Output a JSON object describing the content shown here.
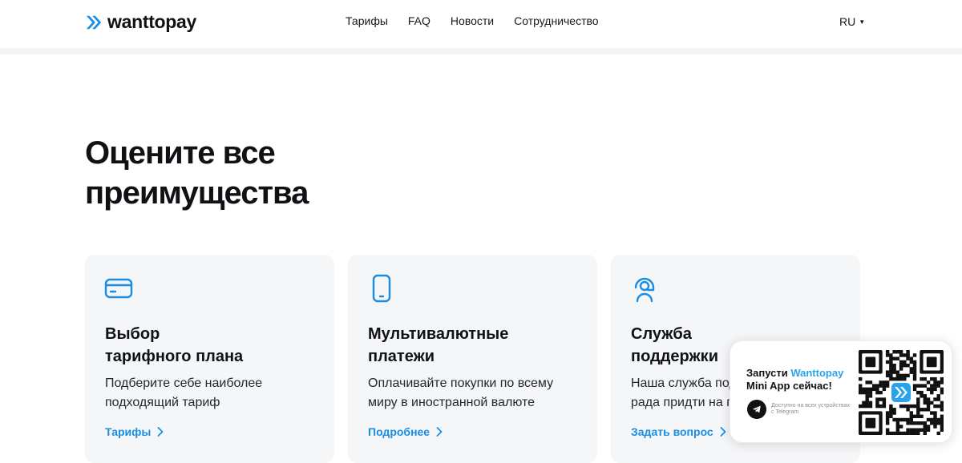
{
  "header": {
    "logo_text": "wanttopay",
    "nav": [
      "Тарифы",
      "FAQ",
      "Новости",
      "Сотрудничество"
    ],
    "language": "RU"
  },
  "hero": {
    "title_line1": "Оцените все",
    "title_line2": "преимущества"
  },
  "cards": [
    {
      "icon": "credit-card-icon",
      "title_line1": "Выбор",
      "title_line2": "тарифного плана",
      "desc_line1": "Подберите себе наиболее",
      "desc_line2": "подходящий тариф",
      "link": "Тарифы"
    },
    {
      "icon": "smartphone-icon",
      "title_line1": "Мультивалютные",
      "title_line2": "платежи",
      "desc_line1": "Оплачивайте покупки по всему",
      "desc_line2": "миру в иностранной валюте",
      "link": "Подробнее"
    },
    {
      "icon": "support-agent-icon",
      "title_line1": "Служба",
      "title_line2": "поддержки",
      "desc_line1": "Наша служба под",
      "desc_line2": "рада придти на п",
      "link": "Задать вопрос"
    }
  ],
  "promo": {
    "title_prefix": "Запусти ",
    "title_brand": "Wanttopay",
    "title_suffix": "Mini App сейчас!",
    "availability": "Доступно на всех устройствах с Telegram"
  },
  "colors": {
    "accent": "#1a8ee5",
    "card_bg": "#f5f6f8",
    "text": "#0f1114"
  }
}
